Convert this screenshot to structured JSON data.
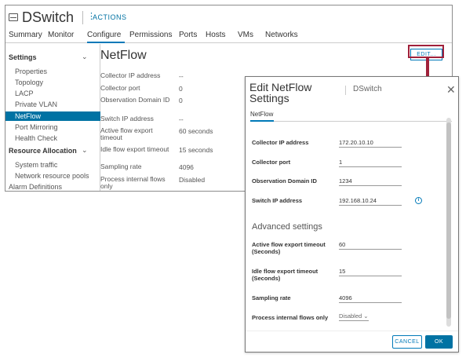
{
  "window": {
    "title": "DSwitch",
    "actions_label": "ACTIONS",
    "tabs": [
      "Summary",
      "Monitor",
      "Configure",
      "Permissions",
      "Ports",
      "Hosts",
      "VMs",
      "Networks"
    ],
    "active_tab": "Configure"
  },
  "sidebar": {
    "settings_header": "Settings",
    "settings_items": [
      "Properties",
      "Topology",
      "LACP",
      "Private VLAN",
      "NetFlow",
      "Port Mirroring",
      "Health Check"
    ],
    "selected_item": "NetFlow",
    "resource_header": "Resource Allocation",
    "resource_items": [
      "System traffic",
      "Network resource pools"
    ],
    "alarm": "Alarm Definitions"
  },
  "netflow": {
    "title": "NetFlow",
    "edit_label": "EDIT...",
    "properties": [
      {
        "label": "Collector IP address",
        "value": "--"
      },
      {
        "label": "Collector port",
        "value": "0"
      },
      {
        "label": "Observation Domain ID",
        "value": "0"
      },
      {
        "label": "Switch IP address",
        "value": "--"
      },
      {
        "label": "Active flow export timeout",
        "value": "60 seconds"
      },
      {
        "label": "Idle flow export timeout",
        "value": "15 seconds"
      },
      {
        "label": "Sampling rate",
        "value": "4096"
      },
      {
        "label": "Process internal flows only",
        "value": "Disabled"
      }
    ]
  },
  "dialog": {
    "title": "Edit NetFlow Settings",
    "subtitle": "DSwitch",
    "tab": "NetFlow",
    "fields": [
      {
        "label": "Collector IP address",
        "value": "172.20.10.10"
      },
      {
        "label": "Collector port",
        "value": "1"
      },
      {
        "label": "Observation Domain ID",
        "value": "1234"
      },
      {
        "label": "Switch IP address",
        "value": "192.168.10.24"
      }
    ],
    "advanced_header": "Advanced settings",
    "advanced_fields": [
      {
        "label": "Active flow export timeout (Seconds)",
        "value": "60"
      },
      {
        "label": "Idle flow export timeout (Seconds)",
        "value": "15"
      },
      {
        "label": "Sampling rate",
        "value": "4096"
      }
    ],
    "process_label": "Process internal flows only",
    "process_value": "Disabled",
    "cancel_label": "CANCEL",
    "ok_label": "OK"
  },
  "colors": {
    "accent": "#0072a3",
    "highlight": "#a0213b"
  }
}
